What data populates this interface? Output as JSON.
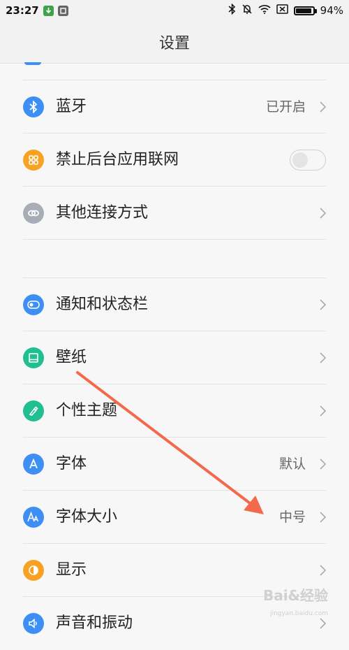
{
  "status_bar": {
    "time": "23:27",
    "battery": "94%",
    "battery_level": 0.94
  },
  "header": {
    "title": "设置"
  },
  "rows": [
    {
      "id": "bluetooth",
      "label": "蓝牙",
      "value": "已开启",
      "icon": "bluetooth-icon",
      "color": "#3d8ef5"
    },
    {
      "id": "block-background-network",
      "label": "禁止后台应用联网",
      "icon": "grid-icon",
      "color": "#f7a223",
      "toggle": false
    },
    {
      "id": "other-connections",
      "label": "其他连接方式",
      "icon": "link-icon",
      "color": "#a6adb6"
    },
    {
      "id": "notifications",
      "label": "通知和状态栏",
      "icon": "toggle-icon",
      "color": "#3d8ef5"
    },
    {
      "id": "wallpaper",
      "label": "壁纸",
      "icon": "image-icon",
      "color": "#1fbf92"
    },
    {
      "id": "theme",
      "label": "个性主题",
      "icon": "brush-icon",
      "color": "#1fbf92"
    },
    {
      "id": "font",
      "label": "字体",
      "value": "默认",
      "icon": "font-icon",
      "color": "#3d8ef5"
    },
    {
      "id": "font-size",
      "label": "字体大小",
      "value": "中号",
      "icon": "font-size-icon",
      "color": "#3d8ef5"
    },
    {
      "id": "display",
      "label": "显示",
      "icon": "brightness-icon",
      "color": "#f7a223"
    },
    {
      "id": "sound",
      "label": "声音和振动",
      "icon": "speaker-icon",
      "color": "#3d8ef5"
    }
  ],
  "annotation": {
    "color": "#f26a4b"
  },
  "watermark": {
    "text": "Bai&经验",
    "sub": "jingyan.baidu.com"
  }
}
